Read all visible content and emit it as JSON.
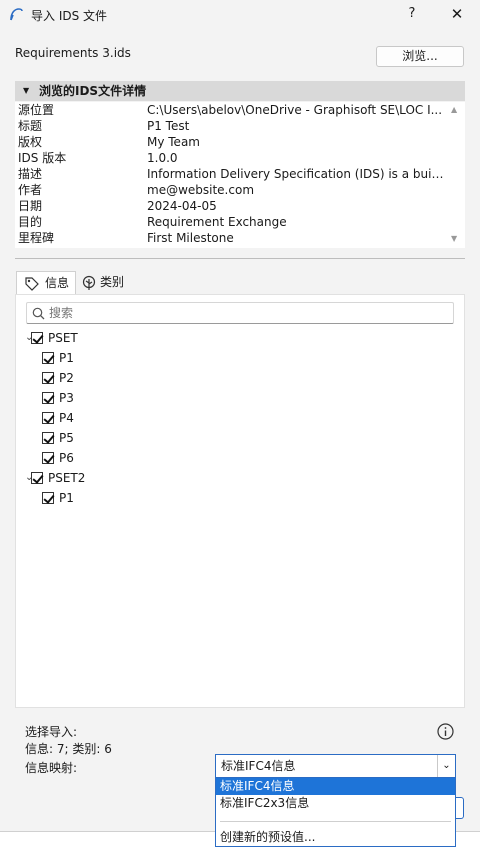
{
  "window": {
    "title": "导入 IDS 文件",
    "help_label": "?",
    "close_label": "✕"
  },
  "file": {
    "name": "Requirements 3.ids",
    "browse_label": "浏览..."
  },
  "details": {
    "header": "浏览的IDS文件详情",
    "rows": [
      {
        "key": "源位置",
        "value": "C:\\Users\\abelov\\OneDrive - Graphisoft SE\\LOC I..."
      },
      {
        "key": "标题",
        "value": "P1 Test"
      },
      {
        "key": "版权",
        "value": "My Team"
      },
      {
        "key": "IDS 版本",
        "value": "1.0.0"
      },
      {
        "key": "描述",
        "value": "Information Delivery Specification (IDS) is a buildi..."
      },
      {
        "key": "作者",
        "value": "me@website.com"
      },
      {
        "key": "日期",
        "value": "2024-04-05"
      },
      {
        "key": "目的",
        "value": "Requirement Exchange"
      },
      {
        "key": "里程碑",
        "value": "First Milestone"
      }
    ]
  },
  "tabs": [
    {
      "label": "信息",
      "icon": "tag-icon",
      "active": true
    },
    {
      "label": "类别",
      "icon": "tree-icon",
      "active": false
    }
  ],
  "search": {
    "placeholder": "搜索",
    "value": ""
  },
  "tree": [
    {
      "label": "PSET",
      "checked": true,
      "expanded": true,
      "children": [
        {
          "label": "P1",
          "checked": true
        },
        {
          "label": "P2",
          "checked": true
        },
        {
          "label": "P3",
          "checked": true
        },
        {
          "label": "P4",
          "checked": true
        },
        {
          "label": "P5",
          "checked": true
        },
        {
          "label": "P6",
          "checked": true
        }
      ]
    },
    {
      "label": "PSET2",
      "checked": true,
      "expanded": true,
      "children": [
        {
          "label": "P1",
          "checked": true
        }
      ]
    }
  ],
  "selection": {
    "title": "选择导入:",
    "counts": "信息: 7; 类别: 6"
  },
  "mapping": {
    "label": "信息映射:",
    "selected": "标准IFC4信息",
    "options": [
      "标准IFC4信息",
      "标准IFC2x3信息"
    ],
    "create_new": "创建新的预设值..."
  },
  "colors": {
    "accent": "#1e74d8",
    "header_bg": "#d9d9d9",
    "window_bg": "#f3f3f3"
  }
}
